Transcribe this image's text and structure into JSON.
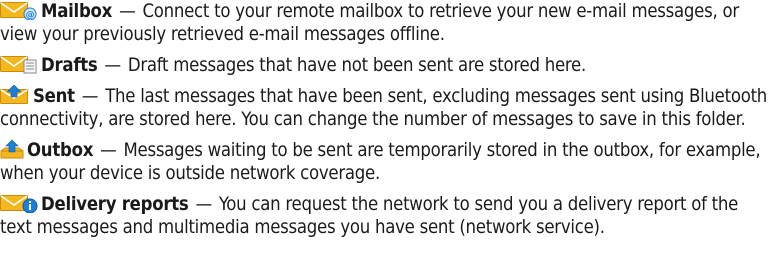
{
  "entries": [
    {
      "term": "Mailbox",
      "dash": "—",
      "text": "Connect to your remote mailbox to retrieve your new e-mail messages, or view your previously retrieved e-mail messages offline.",
      "icon": "mailbox-icon"
    },
    {
      "term": "Drafts",
      "dash": "—",
      "text": "Draft messages that have not been sent are stored here.",
      "icon": "drafts-icon"
    },
    {
      "term": "Sent",
      "dash": "—",
      "text": "The last messages that have been sent, excluding messages sent using Bluetooth connectivity, are stored here. You can change the number of messages to save in this folder.",
      "icon": "sent-icon"
    },
    {
      "term": "Outbox",
      "dash": "—",
      "text": "Messages waiting to be sent are temporarily stored in the outbox, for example, when your device is outside network coverage.",
      "icon": "outbox-icon"
    },
    {
      "term": "Delivery reports",
      "dash": "—",
      "text": "You can request the network to send you a delivery report of the text messages and multimedia messages you have sent (network service).",
      "icon": "delivery-reports-icon"
    }
  ],
  "colors": {
    "envelope": "#f2b51c",
    "envelope_dark": "#c98a0a",
    "badge_blue": "#1d7fd6",
    "text": "#1a1a1a"
  }
}
